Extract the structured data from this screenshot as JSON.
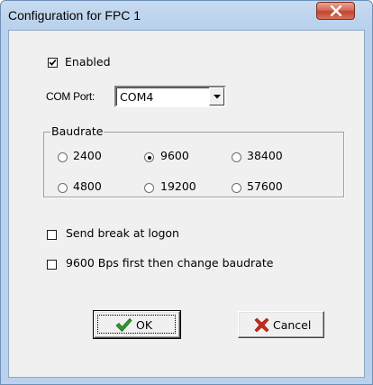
{
  "window": {
    "title": "Configuration for FPC 1"
  },
  "form": {
    "enabled_label": "Enabled",
    "enabled_checked": true,
    "com_port_label": "COM Port:",
    "com_port_value": "COM4",
    "baudrate_legend": "Baudrate",
    "baudrate_options": [
      "2400",
      "9600",
      "38400",
      "4800",
      "19200",
      "57600"
    ],
    "baudrate_selected": "9600",
    "send_break_label": "Send break at logon",
    "send_break_checked": false,
    "bps_first_label": "9600 Bps first then change baudrate",
    "bps_first_checked": false
  },
  "buttons": {
    "ok_label": "OK",
    "ok_icon": "checkmark-icon",
    "cancel_label": "Cancel",
    "cancel_icon": "x-cross-icon"
  },
  "colors": {
    "close_button": "#c2442f",
    "ok_icon": "#2e9a2e",
    "cancel_icon": "#cc2a1c"
  }
}
